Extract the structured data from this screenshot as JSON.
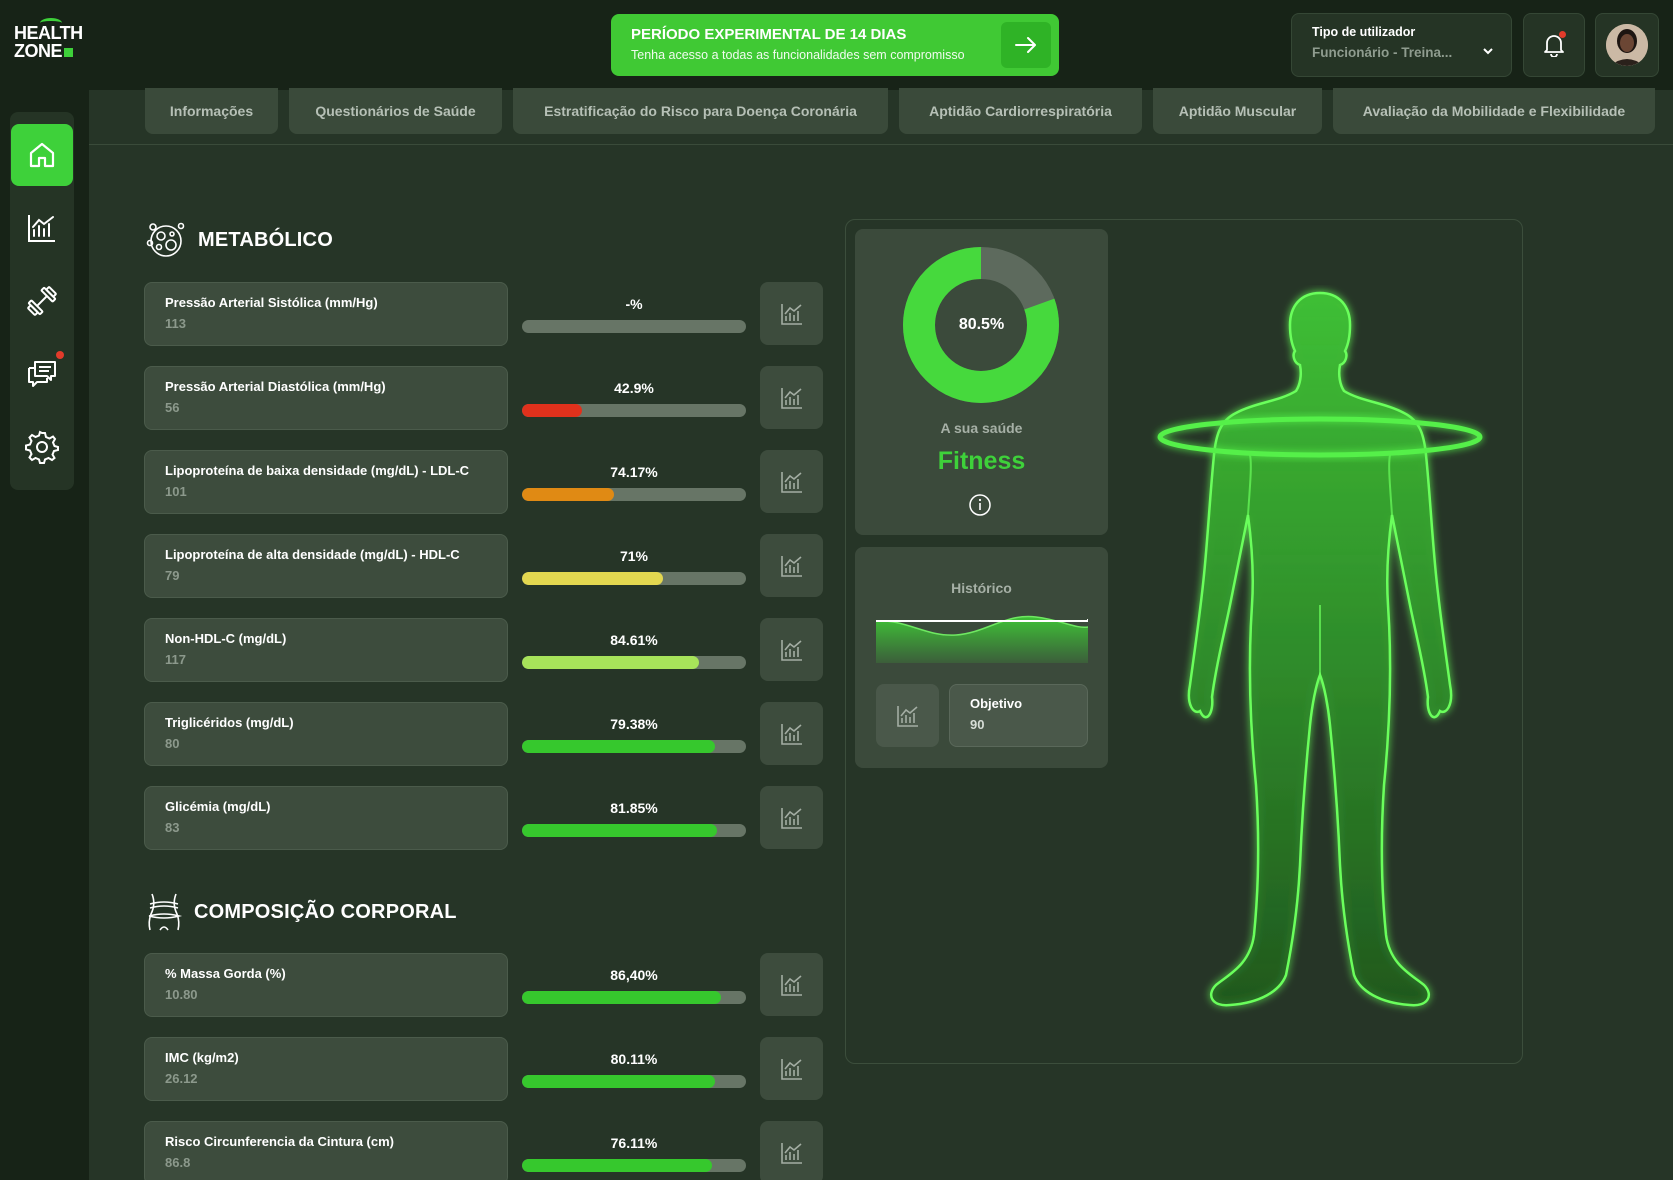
{
  "brand": {
    "logo_line1": "HEALTH",
    "logo_line2": "ZONE",
    "accent": "#3ed13a"
  },
  "trial": {
    "title": "PERÍODO EXPERIMENTAL DE 14 DIAS",
    "subtitle": "Tenha acesso a todas as funcionalidades sem compromisso",
    "arrow_icon": "arrow-right-icon"
  },
  "user_type": {
    "label": "Tipo de utilizador",
    "value": "Funcionário - Treina...",
    "chevron_icon": "chevron-down-icon"
  },
  "notifications": {
    "icon": "bell-icon",
    "has_unread": true
  },
  "sidebar": {
    "items": [
      {
        "icon": "home-icon",
        "active": true
      },
      {
        "icon": "chart-icon",
        "active": false
      },
      {
        "icon": "dumbbell-icon",
        "active": false
      },
      {
        "icon": "chat-icon",
        "active": false,
        "badge": true
      },
      {
        "icon": "gear-icon",
        "active": false
      }
    ]
  },
  "tabs": [
    "Informações",
    "Questionários de Saúde",
    "Estratificação do Risco para Doença Coronária",
    "Aptidão Cardiorrespiratória",
    "Aptidão Muscular",
    "Avaliação da Mobilidade e Flexibilidade"
  ],
  "metabolic": {
    "title": "METABÓLICO",
    "metrics": [
      {
        "label": "Pressão Arterial Sistólica (mm/Hg)",
        "value": "113",
        "pct_text": "-%",
        "pct": 0,
        "color": "#677566"
      },
      {
        "label": "Pressão Arterial Diastólica (mm/Hg)",
        "value": "56",
        "pct_text": "42.9%",
        "pct": 27,
        "color": "#e0311c"
      },
      {
        "label": "Lipoproteína de baixa densidade (mg/dL) - LDL-C",
        "value": "101",
        "pct_text": "74.17%",
        "pct": 41,
        "color": "#e08a14"
      },
      {
        "label": "Lipoproteína de alta densidade (mg/dL) - HDL-C",
        "value": "79",
        "pct_text": "71%",
        "pct": 63,
        "color": "#e3d750"
      },
      {
        "label": "Non-HDL-C (mg/dL)",
        "value": "117",
        "pct_text": "84.61%",
        "pct": 79,
        "color": "#a7e35a"
      },
      {
        "label": "Triglicéridos (mg/dL)",
        "value": "80",
        "pct_text": "79.38%",
        "pct": 86,
        "color": "#36c82d"
      },
      {
        "label": "Glicémia (mg/dL)",
        "value": "83",
        "pct_text": "81.85%",
        "pct": 87,
        "color": "#36c82d"
      }
    ]
  },
  "body_composition": {
    "title": "COMPOSIÇÃO CORPORAL",
    "metrics": [
      {
        "label": "% Massa Gorda (%)",
        "value": "10.80",
        "pct_text": "86,40%",
        "pct": 89,
        "color": "#36c82d"
      },
      {
        "label": "IMC (kg/m2)",
        "value": "26.12",
        "pct_text": "80.11%",
        "pct": 86,
        "color": "#36c82d"
      },
      {
        "label": "Risco Circunferencia da Cintura (cm)",
        "value": "86.8",
        "pct_text": "76.11%",
        "pct": 85,
        "color": "#36c82d"
      }
    ]
  },
  "health": {
    "score_text": "80.5%",
    "score": 80.5,
    "caption": "A sua saúde",
    "status": "Fitness",
    "info_icon": "info-icon"
  },
  "history": {
    "title": "Histórico",
    "chart_icon": "chart-icon",
    "goal_label": "Objetivo",
    "goal_value": "90"
  }
}
